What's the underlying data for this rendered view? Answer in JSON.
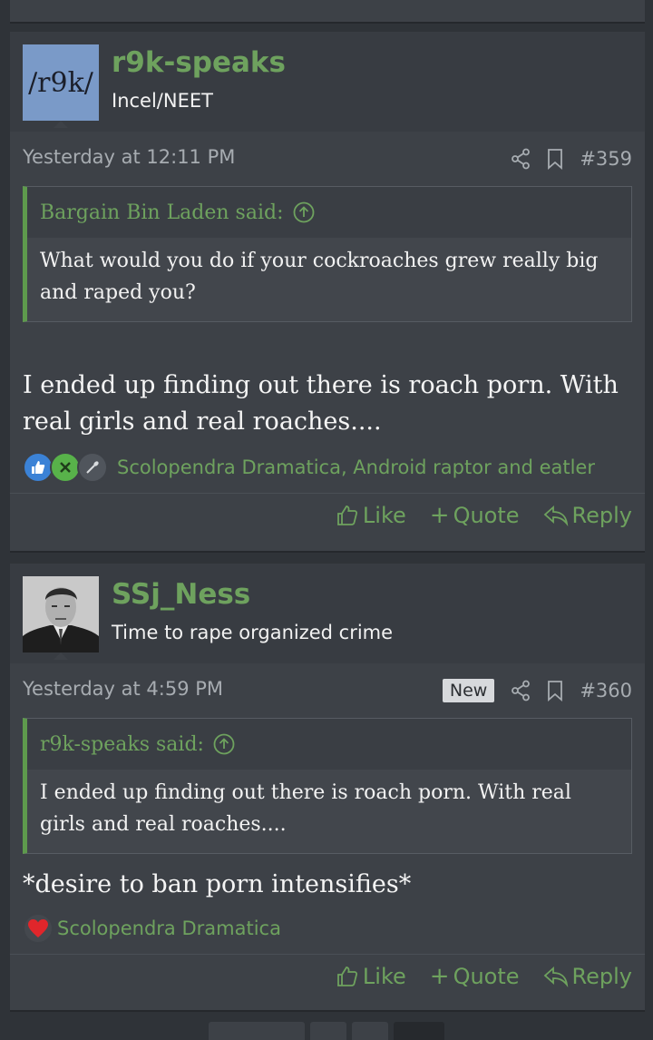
{
  "posts": [
    {
      "avatar_text": "/r9k/",
      "username": "r9k-speaks",
      "user_title": "Incel/NEET",
      "timestamp": "Yesterday at 12:11 PM",
      "is_new": false,
      "post_number": "#359",
      "quote": {
        "author": "Bargain Bin Laden said:",
        "text": "What would you do if your cockroaches grew really big and raped you?"
      },
      "message": "I ended up finding out there is roach porn. With real girls and real roaches....",
      "reactions": {
        "icons": [
          "like-reaction-icon",
          "x-reaction-icon",
          "spoon-reaction-icon"
        ],
        "users": "Scolopendra Dramatica, Android raptor and eatler"
      }
    },
    {
      "username": "SSj_Ness",
      "user_title": "Time to rape organized crime",
      "timestamp": "Yesterday at 4:59 PM",
      "is_new": true,
      "new_label": "New",
      "post_number": "#360",
      "quote": {
        "author": "r9k-speaks said:",
        "text": "I ended up finding out there is roach porn. With real girls and real roaches...."
      },
      "message": "*desire to ban porn intensifies*",
      "reactions": {
        "icons": [
          "heart-reaction-icon"
        ],
        "users": "Scolopendra Dramatica"
      }
    }
  ],
  "actions": {
    "like": "Like",
    "quote": "Quote",
    "reply": "Reply"
  },
  "colors": {
    "accent_green": "#6ea25e",
    "background": "#2f3338",
    "post_bg": "#3d4147"
  }
}
